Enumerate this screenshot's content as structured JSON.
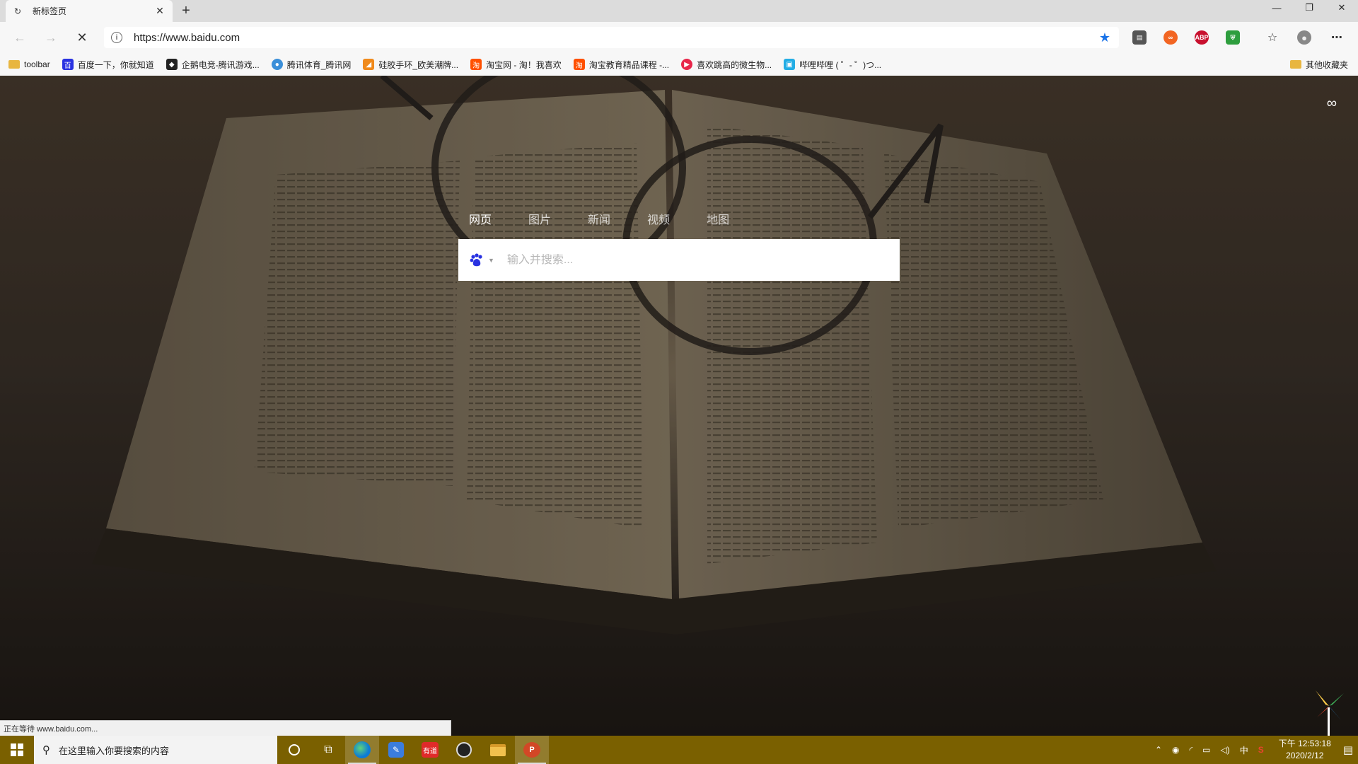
{
  "browser": {
    "tab": {
      "title": "新标签页"
    },
    "address": {
      "url": "https://www.baidu.com"
    },
    "bookmarks": [
      {
        "label": "toolbar",
        "icon": "folder-icon"
      },
      {
        "label": "百度一下，你就知道",
        "icon": "baidu-icon"
      },
      {
        "label": "企鹅电竞-腾讯游戏...",
        "icon": "penguin-icon"
      },
      {
        "label": "腾讯体育_腾讯网",
        "icon": "tencent-sports-icon"
      },
      {
        "label": "硅胶手环_欧美潮牌...",
        "icon": "orange-icon"
      },
      {
        "label": "淘宝网 - 淘！我喜欢",
        "icon": "taobao-icon"
      },
      {
        "label": "淘宝教育精品课程 -...",
        "icon": "taobao-edu-icon"
      },
      {
        "label": "喜欢跳高的微生物...",
        "icon": "red-play-icon"
      },
      {
        "label": "哔哩哔哩 ( ゜- ゜)つ...",
        "icon": "bilibili-icon"
      }
    ],
    "bookmarks_other": "其他收藏夹"
  },
  "page": {
    "search_tabs": [
      "网页",
      "图片",
      "新闻",
      "视频",
      "地图"
    ],
    "search_placeholder": "输入并搜索...",
    "status_text": "正在等待 www.baidu.com..."
  },
  "taskbar": {
    "search_placeholder": "在这里输入你要搜索的内容",
    "time": "下午 12:53:18",
    "date": "2020/2/12",
    "ime": "中",
    "colors": {
      "taskbar_bg": "#7a6000",
      "accent": "#1a73e8"
    }
  }
}
